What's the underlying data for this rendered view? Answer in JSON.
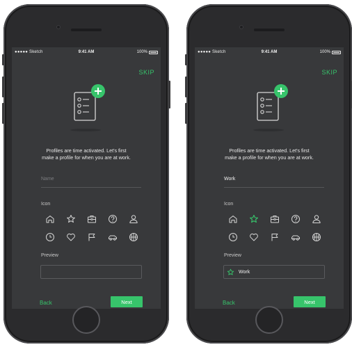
{
  "colors": {
    "accent": "#37c46b",
    "screen_bg": "#38393b",
    "phone_body": "#2b2b2d"
  },
  "screens": [
    {
      "status": {
        "carrier": "●●●●● Sketch",
        "time": "9:41 AM",
        "battery": "100%"
      },
      "skip_label": "SKIP",
      "intro_line1": "Profiles are time activated. Let's first",
      "intro_line2": "make a profile for when you are at work.",
      "name_field": {
        "placeholder": "Name",
        "value": ""
      },
      "icon_section_label": "Icon",
      "icons": [
        "home-icon",
        "star-icon",
        "briefcase-icon",
        "help-icon",
        "user-icon",
        "clock-icon",
        "heart-icon",
        "flag-icon",
        "car-icon",
        "basketball-icon"
      ],
      "selected_icon": "",
      "preview_label": "Preview",
      "preview_text": "",
      "back_label": "Back",
      "next_label": "Next"
    },
    {
      "status": {
        "carrier": "●●●●● Sketch",
        "time": "9:41 AM",
        "battery": "100%"
      },
      "skip_label": "SKIP",
      "intro_line1": "Profiles are time activated. Let's first",
      "intro_line2": "make a profile for when you are at work.",
      "name_field": {
        "placeholder": "Name",
        "value": "Work"
      },
      "icon_section_label": "Icon",
      "icons": [
        "home-icon",
        "star-icon",
        "briefcase-icon",
        "help-icon",
        "user-icon",
        "clock-icon",
        "heart-icon",
        "flag-icon",
        "car-icon",
        "basketball-icon"
      ],
      "selected_icon": "star-icon",
      "preview_label": "Preview",
      "preview_text": "Work",
      "back_label": "Back",
      "next_label": "Next"
    }
  ]
}
